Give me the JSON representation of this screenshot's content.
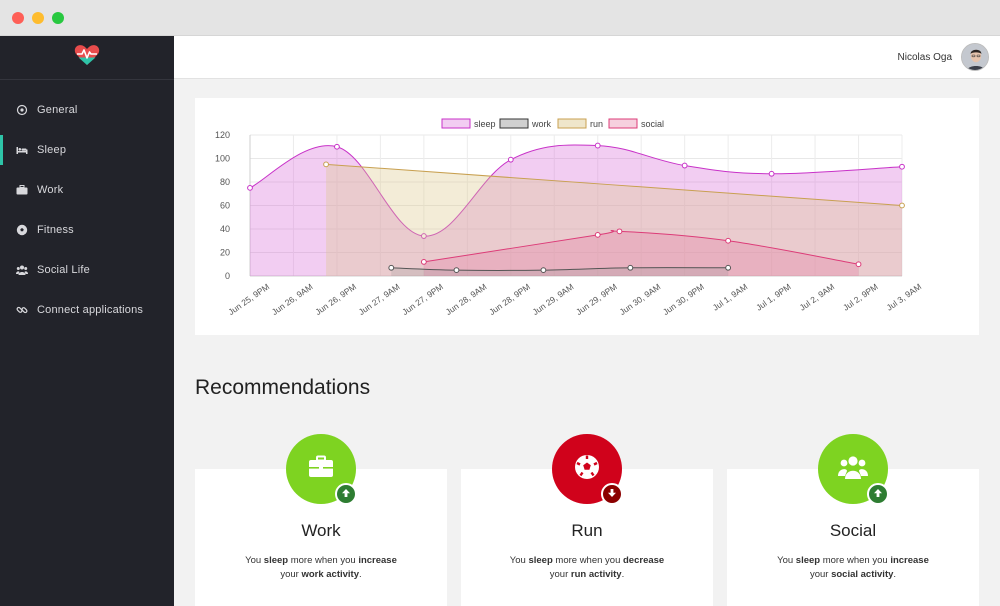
{
  "window": {
    "controls": [
      "close",
      "minimize",
      "maximize"
    ]
  },
  "app": {
    "logo": "heart-pulse-logo",
    "brand_colors": {
      "red": "#e84c4c",
      "teal": "#2ec4a8"
    }
  },
  "sidebar": {
    "items": [
      {
        "label": "General",
        "icon": "target-icon",
        "active": false
      },
      {
        "label": "Sleep",
        "icon": "bed-icon",
        "active": true
      },
      {
        "label": "Work",
        "icon": "briefcase-icon",
        "active": false
      },
      {
        "label": "Fitness",
        "icon": "soccer-ball-icon",
        "active": false
      },
      {
        "label": "Social Life",
        "icon": "users-icon",
        "active": false
      },
      {
        "label": "Connect applications",
        "icon": "link-icon",
        "active": false
      }
    ]
  },
  "header": {
    "user_name": "Nicolas Oga",
    "avatar": "user-avatar"
  },
  "chart_data": {
    "type": "area",
    "legend": [
      "sleep",
      "work",
      "run",
      "social"
    ],
    "legend_position": "top",
    "ylim": [
      0,
      120
    ],
    "y_ticks": [
      "0",
      "20",
      "40",
      "60",
      "80",
      "100",
      "120"
    ],
    "x_ticks": [
      "Jun 25, 9PM",
      "Jun 26, 9AM",
      "Jun 26, 9PM",
      "Jun 27, 9AM",
      "Jun 27, 9PM",
      "Jun 28, 9AM",
      "Jun 28, 9PM",
      "Jun 29, 9AM",
      "Jun 29, 9PM",
      "Jun 30, 9AM",
      "Jun 30, 9PM",
      "Jul 1, 9AM",
      "Jul 1, 9PM",
      "Jul 2, 9AM",
      "Jul 2, 9PM",
      "Jul 3, 9AM"
    ],
    "grid": true,
    "series": [
      {
        "name": "sleep",
        "color": "#c832c8",
        "fill": "rgba(214,101,214,0.32)",
        "points": [
          [
            "Jun 25, 9PM",
            75
          ],
          [
            "Jun 26, 9PM",
            110
          ],
          [
            "Jun 27, 9PM",
            34
          ],
          [
            "Jun 28, 9PM",
            99
          ],
          [
            "Jun 29, 9PM",
            111
          ],
          [
            "Jun 30, 9PM",
            94
          ],
          [
            "Jul 1, 9PM",
            87
          ],
          [
            "Jul 3, 9AM",
            93
          ]
        ]
      },
      {
        "name": "run",
        "color": "#c8a050",
        "fill": "rgba(220,200,140,0.35)",
        "points": [
          [
            "Jun 26, 6PM",
            95
          ],
          [
            "Jul 3, 9AM",
            60
          ]
        ]
      },
      {
        "name": "social",
        "color": "#dc3c78",
        "fill": "rgba(230,120,160,0.30)",
        "points": [
          [
            "Jun 27, 9PM",
            12
          ],
          [
            "Jun 29, 9PM",
            35
          ],
          [
            "Jun 30, 3AM",
            38
          ],
          [
            "Jul 1, 9AM",
            30
          ],
          [
            "Jul 2, 9PM",
            10
          ]
        ]
      },
      {
        "name": "work",
        "color": "#555555",
        "fill": "rgba(150,150,150,0.25)",
        "points": [
          [
            "Jun 27, 12PM",
            7
          ],
          [
            "Jun 28, 6AM",
            5
          ],
          [
            "Jun 29, 6AM",
            5
          ],
          [
            "Jun 30, 6AM",
            7
          ],
          [
            "Jul 1, 9AM",
            7
          ]
        ]
      }
    ]
  },
  "recommendations": {
    "title": "Recommendations",
    "cards": [
      {
        "name": "Work",
        "icon": "briefcase-icon",
        "circle_color": "#7ed321",
        "badge_color": "#2e7d32",
        "badge_icon": "arrow-up-icon",
        "t1": "You ",
        "b1": "sleep",
        "t2": " more when you ",
        "b2": "increase",
        "t3": "your ",
        "b3": "work activity",
        "t4": "."
      },
      {
        "name": "Run",
        "icon": "soccer-ball-icon",
        "circle_color": "#d0021b",
        "badge_color": "#8b0000",
        "badge_icon": "arrow-down-icon",
        "t1": "You ",
        "b1": "sleep",
        "t2": " more when you ",
        "b2": "decrease",
        "t3": "your ",
        "b3": "run activity",
        "t4": "."
      },
      {
        "name": "Social",
        "icon": "users-icon",
        "circle_color": "#7ed321",
        "badge_color": "#2e7d32",
        "badge_icon": "arrow-up-icon",
        "t1": "You ",
        "b1": "sleep",
        "t2": " more when you ",
        "b2": "increase",
        "t3": "your ",
        "b3": "social activity",
        "t4": "."
      }
    ]
  }
}
